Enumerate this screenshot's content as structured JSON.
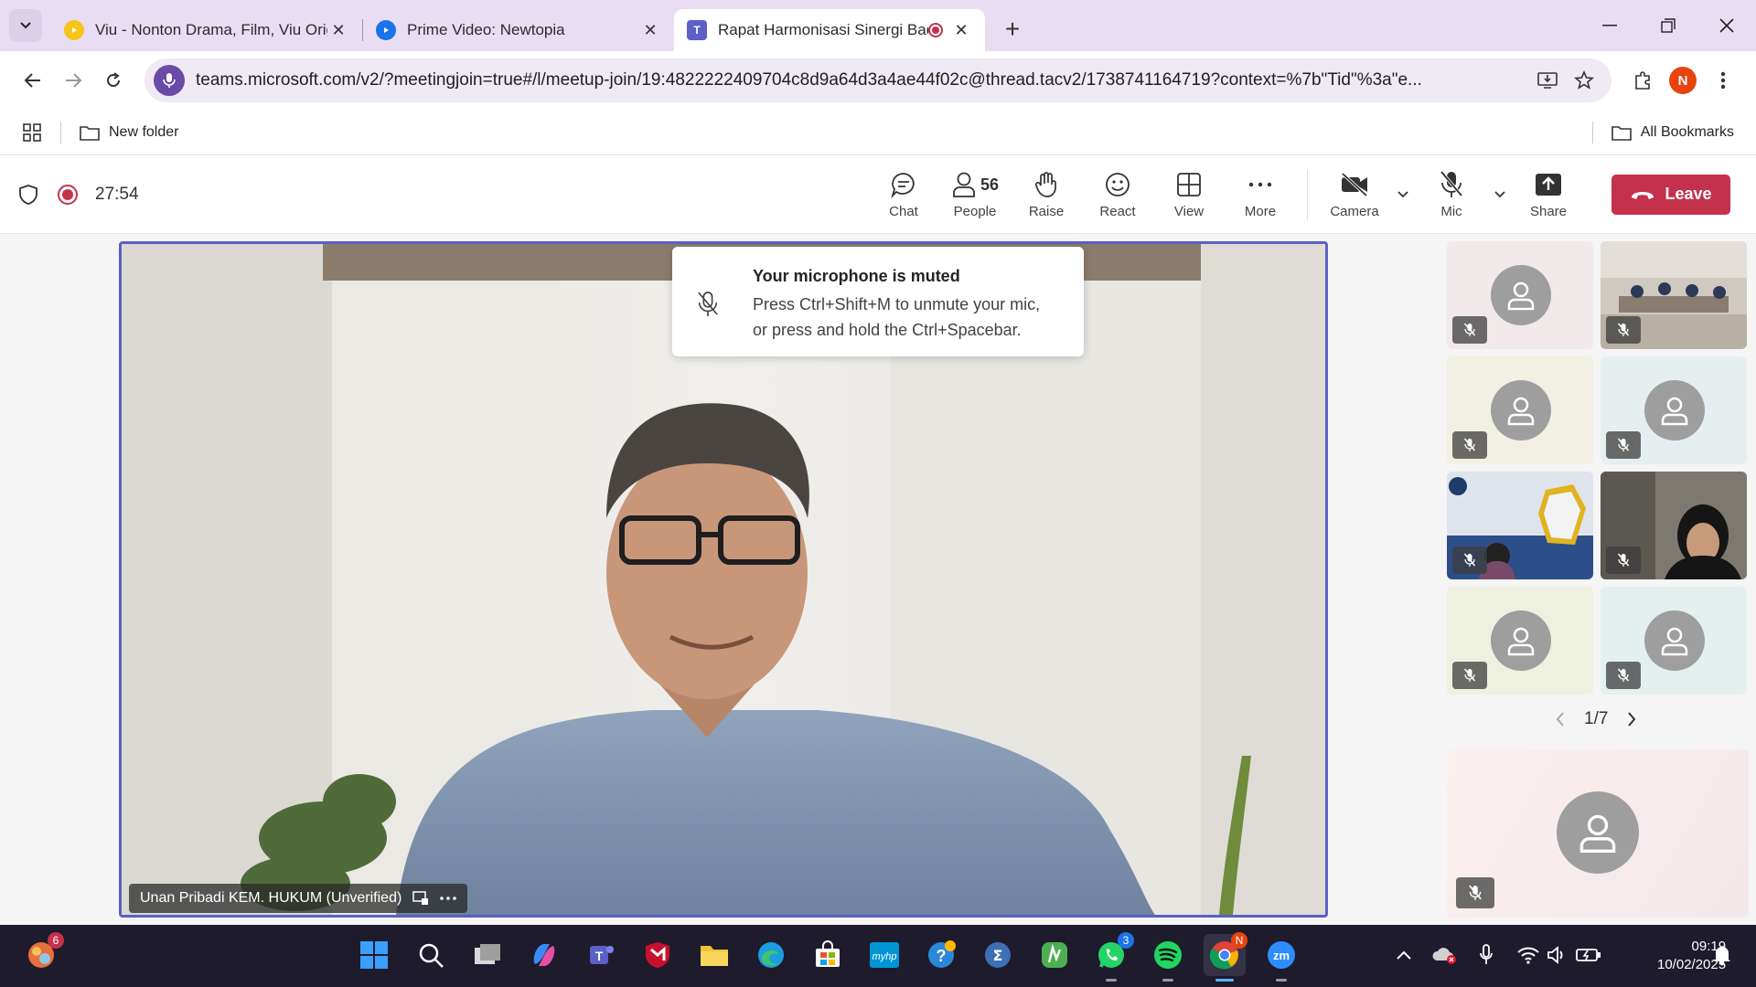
{
  "browser": {
    "tabs": [
      {
        "title": "Viu - Nonton Drama, Film, Viu Original",
        "favicon": "viu-icon",
        "favcolor": "#f5c518"
      },
      {
        "title": "Prime Video: Newtopia",
        "favicon": "prime-video-icon",
        "favcolor": "#1a73e8"
      },
      {
        "title": "Rapat Harmonisasi Sinergi Badan",
        "favicon": "teams-icon",
        "favcolor": "#5b5fc7",
        "recording": true
      }
    ],
    "new_tab": "+",
    "url": "teams.microsoft.com/v2/?meetingjoin=true#/l/meetup-join/19:4822222409704c8d9a64d3a4ae44f02c@thread.tacv2/1738741164719?context=%7b\"Tid\"%3a\"e...",
    "profile_initial": "N",
    "bookmarks": {
      "folder": "New folder",
      "all": "All Bookmarks"
    }
  },
  "teams": {
    "timer": "27:54",
    "people_count": "56",
    "controls": [
      "Chat",
      "People",
      "Raise",
      "React",
      "View",
      "More",
      "Camera",
      "Mic",
      "Share"
    ],
    "leave": "Leave"
  },
  "toast": {
    "title": "Your microphone is muted",
    "body_1": "Press Ctrl+Shift+M to unmute your mic,",
    "body_2": "or press and hold the Ctrl+Spacebar."
  },
  "main_video": {
    "name": "Unan Pribadi KEM. HUKUM (Unverified)"
  },
  "gallery": {
    "page": "1/7"
  },
  "taskbar": {
    "time": "09:19",
    "date": "10/02/2025",
    "badges": {
      "widgets": "6",
      "whatsapp": "3",
      "chrome": "N"
    }
  },
  "colors": {
    "accent": "#5b5fc7",
    "leave": "#c4314b",
    "tabstrip": "#e9ddf3"
  }
}
